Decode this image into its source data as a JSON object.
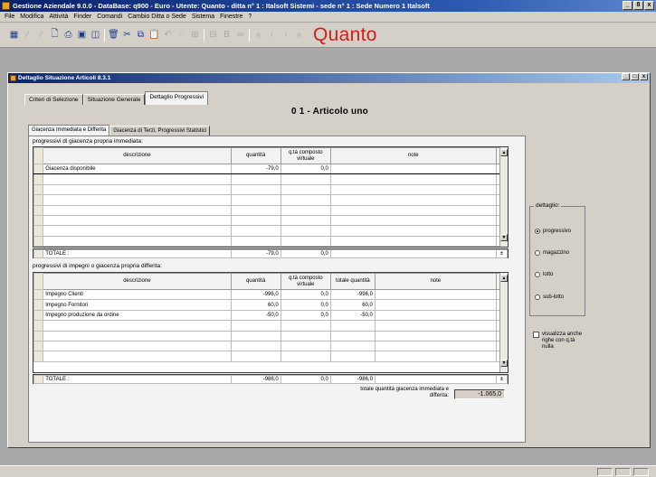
{
  "app": {
    "title": "Gestione Aziendale 9.0.0 - DataBase: q900 - Euro - Utente: Quanto - ditta n° 1 : Italsoft Sistemi - sede n° 1 : Sede Numero 1 Italsoft",
    "sys_buttons": [
      "_",
      "8",
      "x"
    ]
  },
  "menu": [
    "File",
    "Modifica",
    "Attività",
    "Finder",
    "Comandi",
    "Cambio Ditta o Sede",
    "Sistema",
    "Finestre",
    "?"
  ],
  "brand": "Quanto",
  "child_window": {
    "title": "Dettaglio Situazione Articoli 8.3.1",
    "sys_buttons": [
      "_",
      "□",
      "x"
    ]
  },
  "tabs_main": [
    "Criteri di Selezione",
    "Situazione Generale",
    "Dettaglio Progressivi"
  ],
  "article_heading": "0 1 - Articolo uno",
  "tabs_sub": [
    "Giacenza Immediata e Differita",
    "Giacenza di Terzi, Progressivi Statistici"
  ],
  "section1": {
    "label": "progressivi di giacenza propria immediata:",
    "columns": [
      "descrizione",
      "quantità",
      "q.tà composto virtuale",
      "note"
    ],
    "rows": [
      {
        "descrizione": "Giacenza disponibile",
        "quantita": "-79,0",
        "virtuale": "0,0",
        "note": ""
      }
    ],
    "total": {
      "label": "TOTALE :",
      "quantita": "-79,0",
      "virtuale": "0,0"
    }
  },
  "section2": {
    "label": "progressivi di impegni o giacenza propria differita:",
    "columns": [
      "descrizione",
      "quantità",
      "q.tà composto virtuale",
      "totale quantità",
      "note"
    ],
    "rows": [
      {
        "descrizione": "Impegno Clienti",
        "quantita": "-996,0",
        "virtuale": "0,0",
        "totale": "-996,0",
        "note": ""
      },
      {
        "descrizione": "Impegno Fornitori",
        "quantita": "60,0",
        "virtuale": "0,0",
        "totale": "60,0",
        "note": ""
      },
      {
        "descrizione": "Impegno produzione da ordine",
        "quantita": "-50,0",
        "virtuale": "0,0",
        "totale": "-50,0",
        "note": ""
      }
    ],
    "total": {
      "label": "TOTALE :",
      "quantita": "-986,0",
      "virtuale": "0,0",
      "totale": "-986,0"
    }
  },
  "grand_total": {
    "label": "totale quantità giacenza immediata e differita:",
    "value": "-1.065,0"
  },
  "dettaglio": {
    "legend": "dettaglio:",
    "options": [
      {
        "label": "progressivo",
        "selected": true
      },
      {
        "label": "magazzino",
        "selected": false
      },
      {
        "label": "lotto",
        "selected": false
      },
      {
        "label": "sub-lotto",
        "selected": false
      }
    ]
  },
  "visualizza": {
    "label": "visualizza anche righe con q.tà nulla",
    "checked": false
  }
}
